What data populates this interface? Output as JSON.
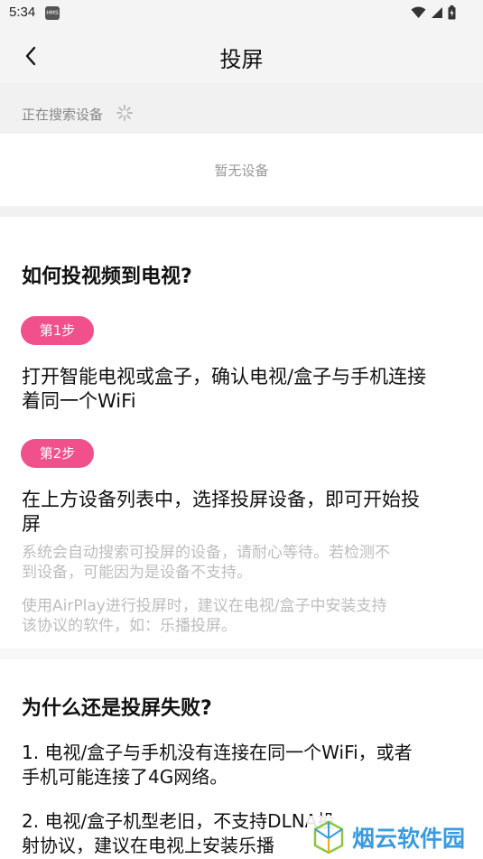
{
  "status_bar": {
    "time": "5:34",
    "hms_badge": "HMS",
    "icons": [
      "wifi-icon",
      "signal-icon",
      "battery-icon"
    ]
  },
  "header": {
    "title": "投屏",
    "back_icon": "chevron-left-icon"
  },
  "search": {
    "status_text": "正在搜索设备",
    "spinner_icon": "loading-spinner-icon"
  },
  "devices": {
    "empty_text": "暂无设备"
  },
  "guide": {
    "heading": "如何投视频到电视?",
    "steps": [
      {
        "badge": "第1步",
        "line1": "打开智能电视或盒子，确认电视/盒子与手机连接",
        "line2": "着同一个WiFi"
      },
      {
        "badge": "第2步",
        "line1": "在上方设备列表中，选择投屏设备，即可开始投",
        "line2": "屏"
      }
    ],
    "notes": [
      {
        "line1": "系统会自动搜索可投屏的设备，请耐心等待。若检测不",
        "line2": "到设备，可能因为是设备不支持。"
      },
      {
        "line1": "使用AirPlay进行投屏时，建议在电视/盒子中安装支持",
        "line2": "该协议的软件，如：乐播投屏。"
      }
    ]
  },
  "faq": {
    "heading": "为什么还是投屏失败?",
    "reasons": [
      {
        "line1": "1. 电视/盒子与手机没有连接在同一个WiFi，或者",
        "line2": "手机可能连接了4G网络。"
      },
      {
        "line1": "2. 电视/盒子机型老旧，不支持DLNA投",
        "line2": "射协议，建议在电视上安装乐播"
      }
    ]
  },
  "watermark": {
    "text": "烟云软件园",
    "logo_icon": "cube-logo-icon"
  },
  "colors": {
    "accent_pink": "#f0508c",
    "watermark_blue": "#3a9be0"
  }
}
